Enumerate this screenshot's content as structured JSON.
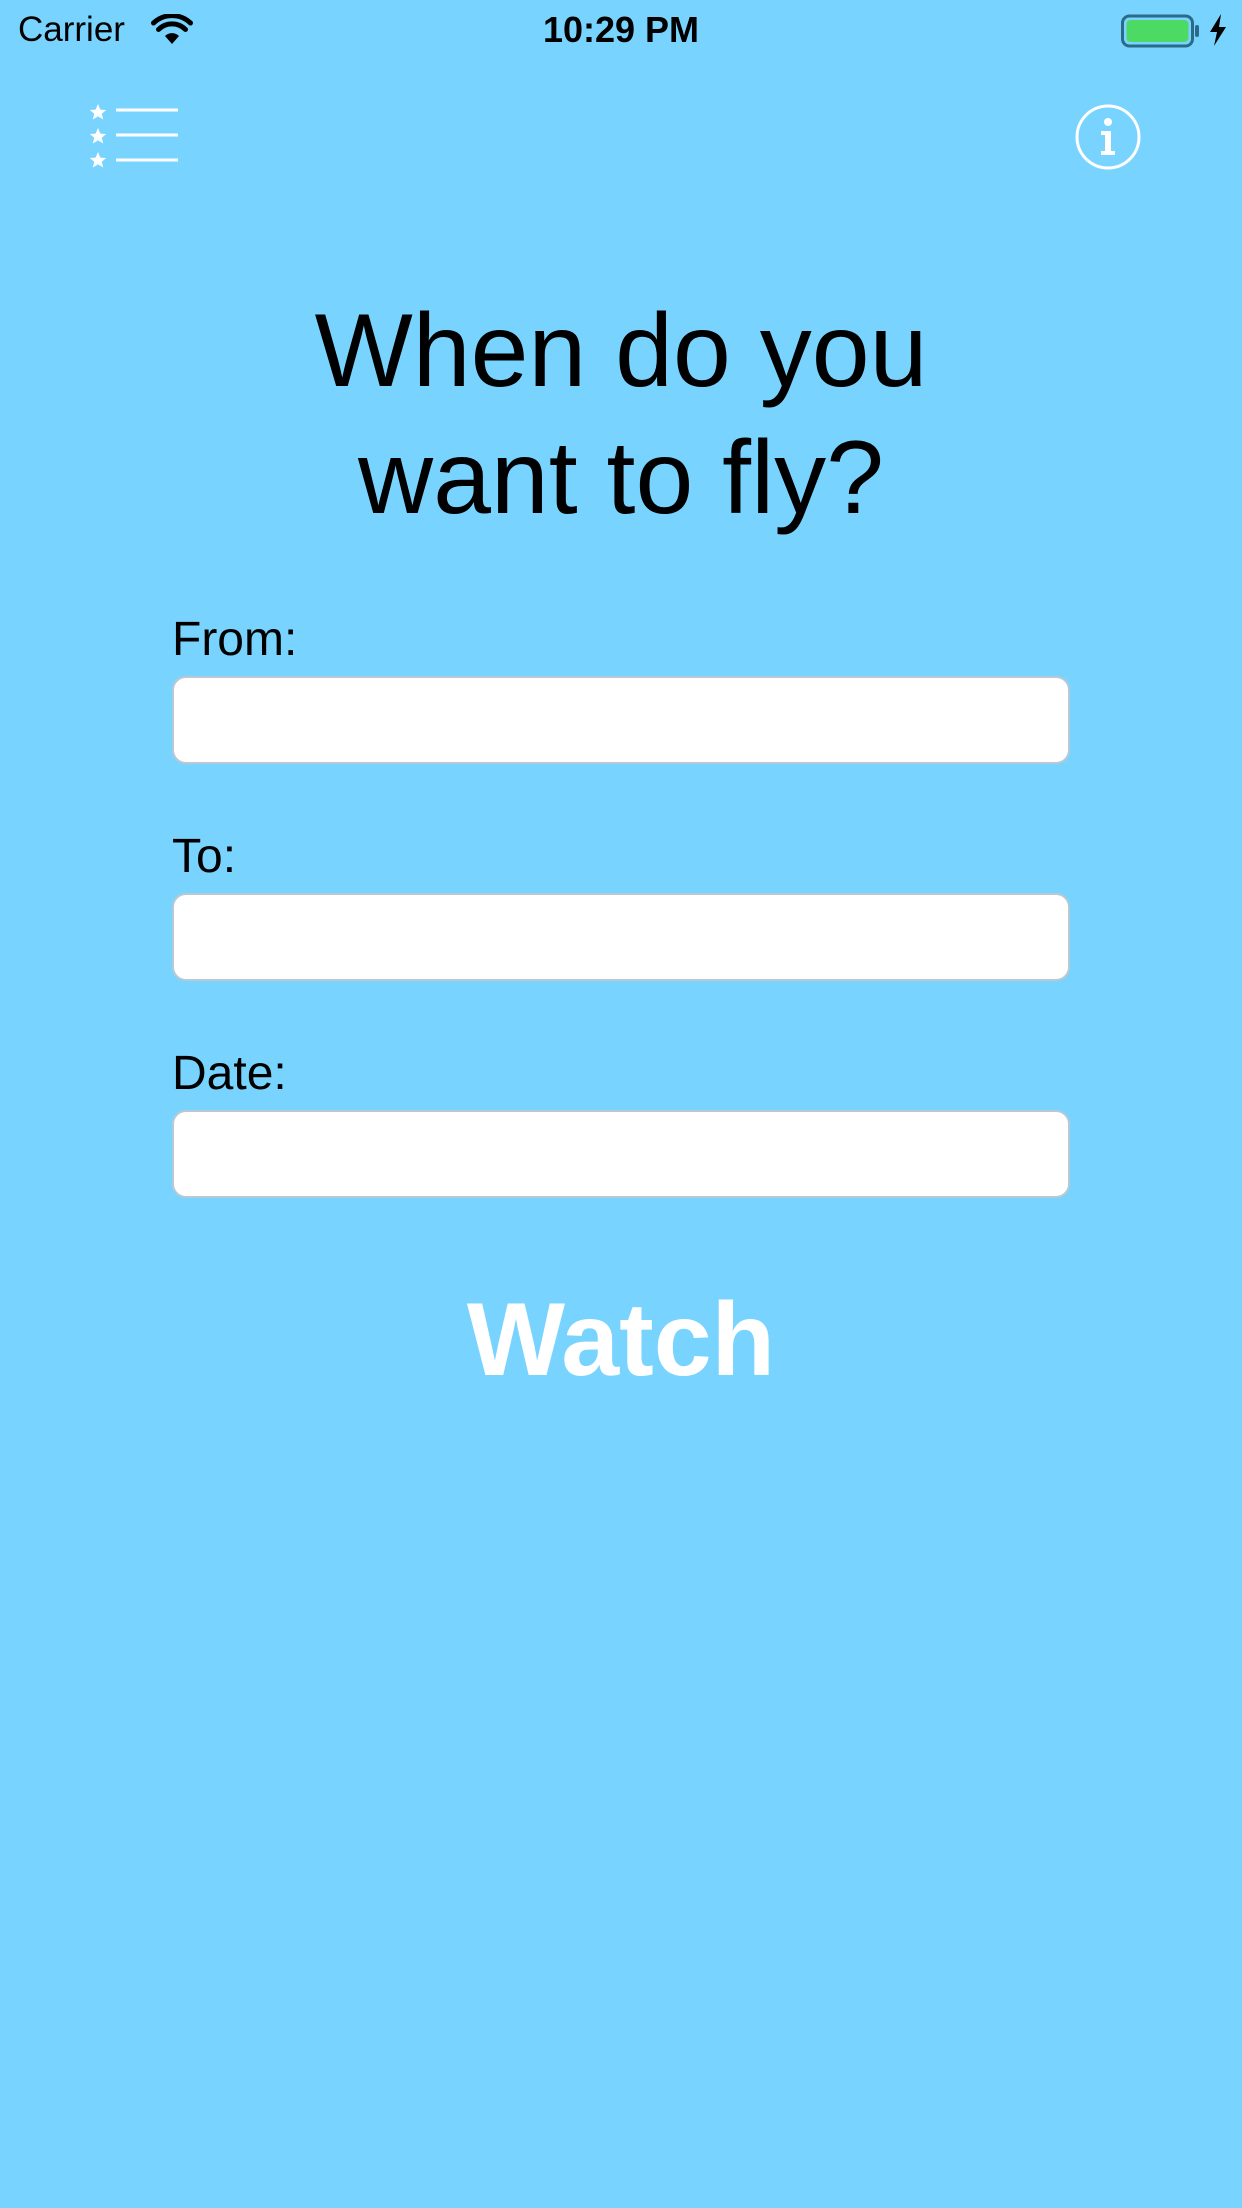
{
  "status_bar": {
    "carrier": "Carrier",
    "time": "10:29 PM",
    "battery_color": "#4cd964"
  },
  "nav": {
    "menu_icon": "starred-list-icon",
    "info_icon": "info-icon"
  },
  "headline": {
    "line1": "When do you",
    "line2": "want to fly?"
  },
  "form": {
    "from_label": "From:",
    "from_value": "",
    "to_label": "To:",
    "to_value": "",
    "date_label": "Date:",
    "date_value": ""
  },
  "watch_button": {
    "label": "Watch"
  },
  "colors": {
    "background": "#78d4fe",
    "button_text": "#ffffff"
  }
}
